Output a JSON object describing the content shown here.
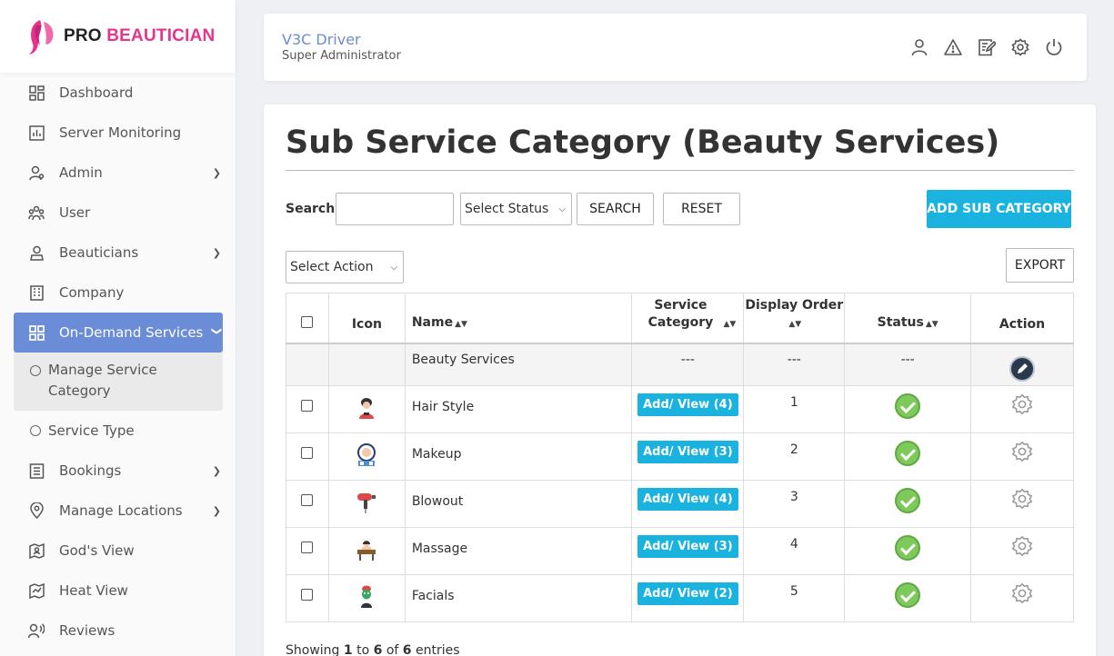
{
  "brand": {
    "pro": "PRO",
    "beautician": "BEAUTICIAN"
  },
  "sidebar": {
    "items": [
      {
        "label": "Dashboard",
        "icon": "dashboard-icon",
        "arrow": false
      },
      {
        "label": "Server Monitoring",
        "icon": "chart-icon",
        "arrow": false
      },
      {
        "label": "Admin",
        "icon": "admin-user-icon",
        "arrow": true
      },
      {
        "label": "User",
        "icon": "users-icon",
        "arrow": false
      },
      {
        "label": "Beauticians",
        "icon": "person-icon",
        "arrow": true
      },
      {
        "label": "Company",
        "icon": "building-icon",
        "arrow": false
      },
      {
        "label": "On-Demand Services",
        "icon": "grid-icon",
        "arrow": true,
        "active": true
      },
      {
        "label": "Manage Service Category",
        "sub": true,
        "selected": true
      },
      {
        "label": "Service Type",
        "sub": true
      },
      {
        "label": "Bookings",
        "icon": "list-icon",
        "arrow": true
      },
      {
        "label": "Manage Locations",
        "icon": "pin-icon",
        "arrow": true
      },
      {
        "label": "God's View",
        "icon": "map-person-icon",
        "arrow": false
      },
      {
        "label": "Heat View",
        "icon": "heatmap-icon",
        "arrow": false
      },
      {
        "label": "Reviews",
        "icon": "review-icon",
        "arrow": false
      }
    ]
  },
  "header": {
    "user_name": "V3C Driver",
    "user_role": "Super Administrator",
    "icons": [
      "profile-icon",
      "alert-icon",
      "edit-note-icon",
      "settings-icon",
      "power-icon"
    ]
  },
  "main": {
    "title": "Sub Service Category (Beauty Services)",
    "search_label": "Search:",
    "search_value": "",
    "status_select": "Select Status",
    "search_button": "SEARCH",
    "reset_button": "RESET",
    "add_button": "ADD SUB CATEGORY",
    "action_select": "Select Action",
    "export_button": "EXPORT"
  },
  "table": {
    "headers": {
      "icon": "Icon",
      "name": "Name",
      "service_category": "Service Category",
      "display_order": "Display Order",
      "status": "Status",
      "action": "Action"
    },
    "parent_row": {
      "name": "Beauty Services",
      "category": "---",
      "order": "---",
      "status": "---"
    },
    "rows": [
      {
        "name": "Hair Style",
        "button": "Add/ View (4)",
        "order": "1",
        "icon": "hairstyle-icon"
      },
      {
        "name": "Makeup",
        "button": "Add/ View (3)",
        "order": "2",
        "icon": "makeup-icon"
      },
      {
        "name": "Blowout",
        "button": "Add/ View (4)",
        "order": "3",
        "icon": "hairdryer-icon"
      },
      {
        "name": "Massage",
        "button": "Add/ View (3)",
        "order": "4",
        "icon": "massage-icon"
      },
      {
        "name": "Facials",
        "button": "Add/ View (2)",
        "order": "5",
        "icon": "facial-icon"
      }
    ]
  },
  "footer": {
    "prefix": "Showing",
    "from": "1",
    "to_word": "to",
    "to": "6",
    "of_word": "of",
    "total": "6",
    "suffix": "entries"
  },
  "colors": {
    "accent": "#1ab3e0",
    "active_nav": "#6b8cd6",
    "brand_pink": "#e6348d",
    "status_green": "#7dca5b"
  }
}
